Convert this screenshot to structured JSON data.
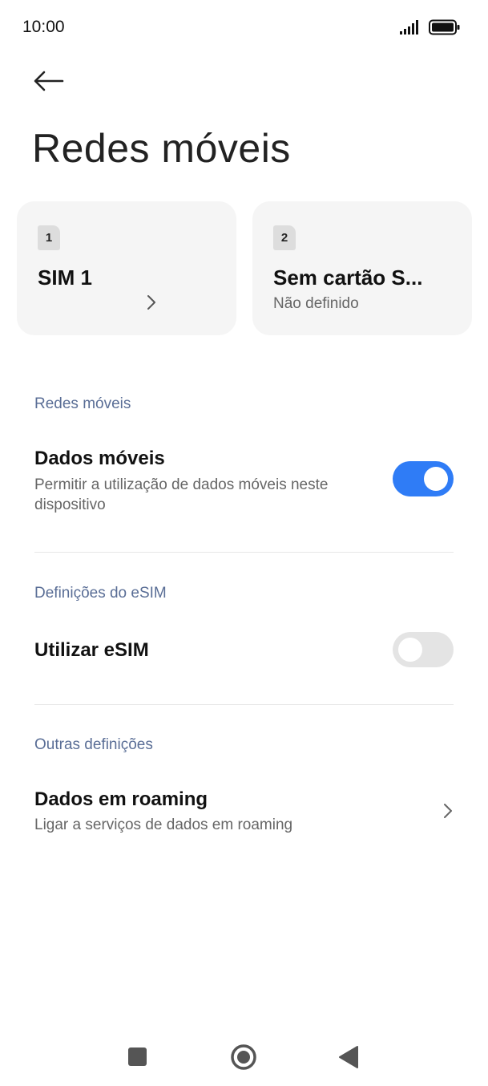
{
  "status_bar": {
    "time": "10:00",
    "icons": [
      "signal-icon",
      "battery-icon"
    ]
  },
  "header": {
    "back_icon": "arrow-left-icon",
    "title": "Redes móveis"
  },
  "sim_cards": [
    {
      "badge": "1",
      "name": "SIM 1",
      "subtitle": "",
      "chevron_icon": "chevron-right-icon"
    },
    {
      "badge": "2",
      "name": "Sem cartão S...",
      "subtitle": "Não definido"
    }
  ],
  "sections": {
    "mobile_networks": {
      "header": "Redes móveis",
      "mobile_data": {
        "title": "Dados móveis",
        "subtitle": "Permitir a utilização de dados móveis neste dispositivo",
        "enabled": true
      }
    },
    "esim": {
      "header": "Definições do eSIM",
      "use_esim": {
        "title": "Utilizar eSIM",
        "enabled": false
      }
    },
    "other": {
      "header": "Outras definições",
      "roaming": {
        "title": "Dados em roaming",
        "subtitle": "Ligar a serviços de dados em roaming"
      }
    }
  },
  "nav_bar": {
    "icons": [
      "recents-square-icon",
      "home-circle-icon",
      "back-triangle-icon"
    ]
  },
  "colors": {
    "accent": "#2f7cf6",
    "section_header": "#5a6e96",
    "card_bg": "#f5f5f5",
    "toggle_off": "#e4e4e4"
  }
}
